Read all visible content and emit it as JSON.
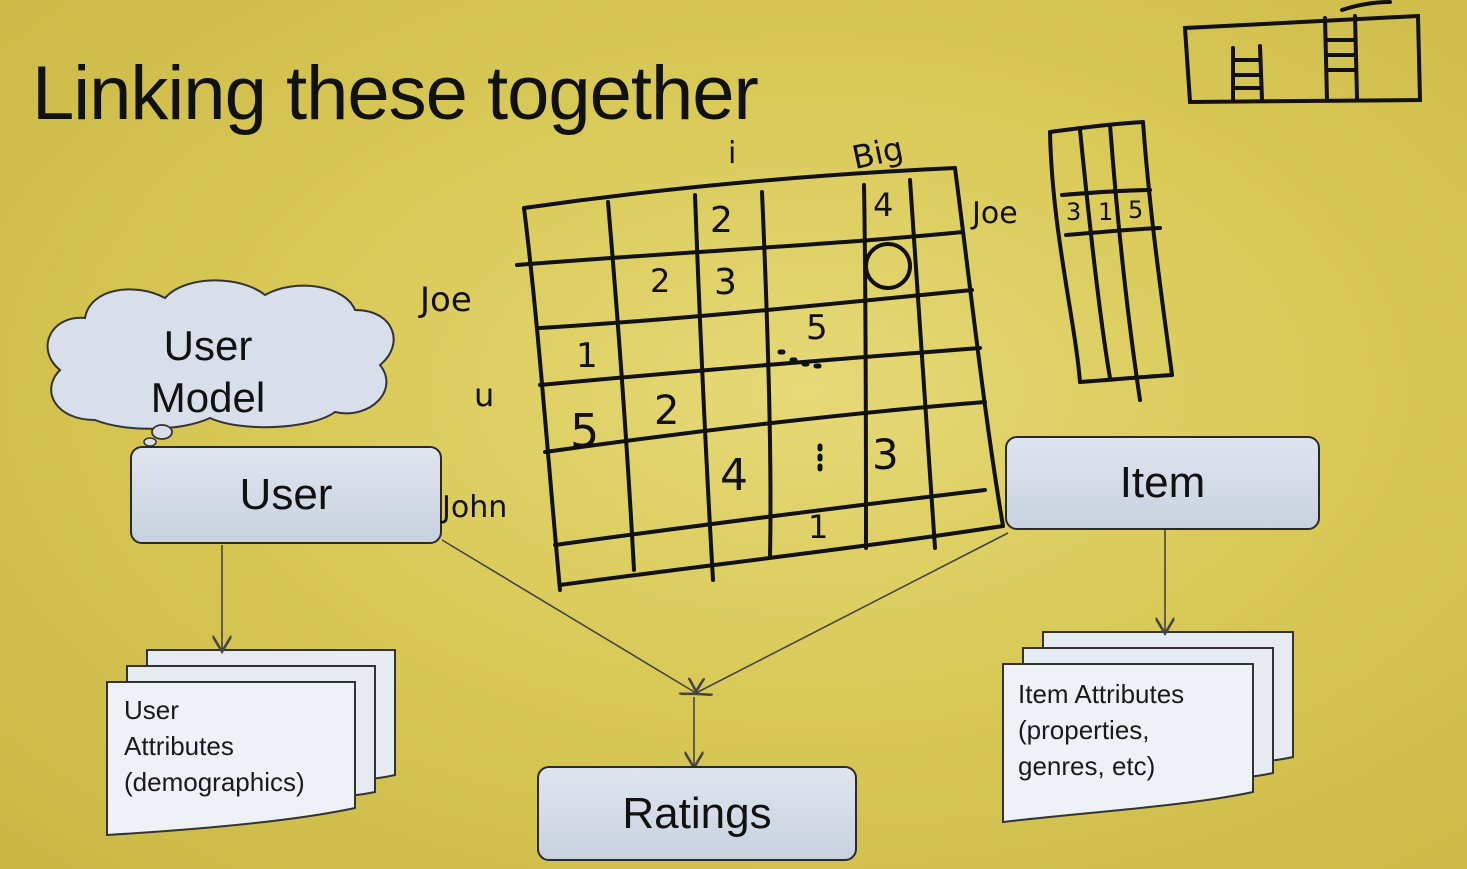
{
  "slide": {
    "title": "Linking these together"
  },
  "cloud": {
    "line1": "User",
    "line2": "Model"
  },
  "boxes": {
    "user": "User",
    "item": "Item",
    "ratings": "Ratings"
  },
  "user_attributes": {
    "line1": "User",
    "line2": "Attributes",
    "line3": "(demographics)"
  },
  "item_attributes": {
    "line1": "Item Attributes",
    "line2": "(properties,",
    "line3": "genres, etc)"
  },
  "handwriting": {
    "row_labels": [
      "Joe",
      "u",
      "John"
    ],
    "col_label_i": "i",
    "col_label_big": "Big",
    "side_label_joe": "Joe",
    "side_vector_values": [
      "3",
      "1",
      "5"
    ],
    "matrix_values": [
      "2",
      "4",
      "2",
      "3",
      "5",
      "1",
      "5",
      "2",
      "4",
      "3",
      "1"
    ]
  },
  "colors": {
    "slide_background": "#d9c957",
    "box_fill": "#d6dce8",
    "ink": "#111111"
  }
}
